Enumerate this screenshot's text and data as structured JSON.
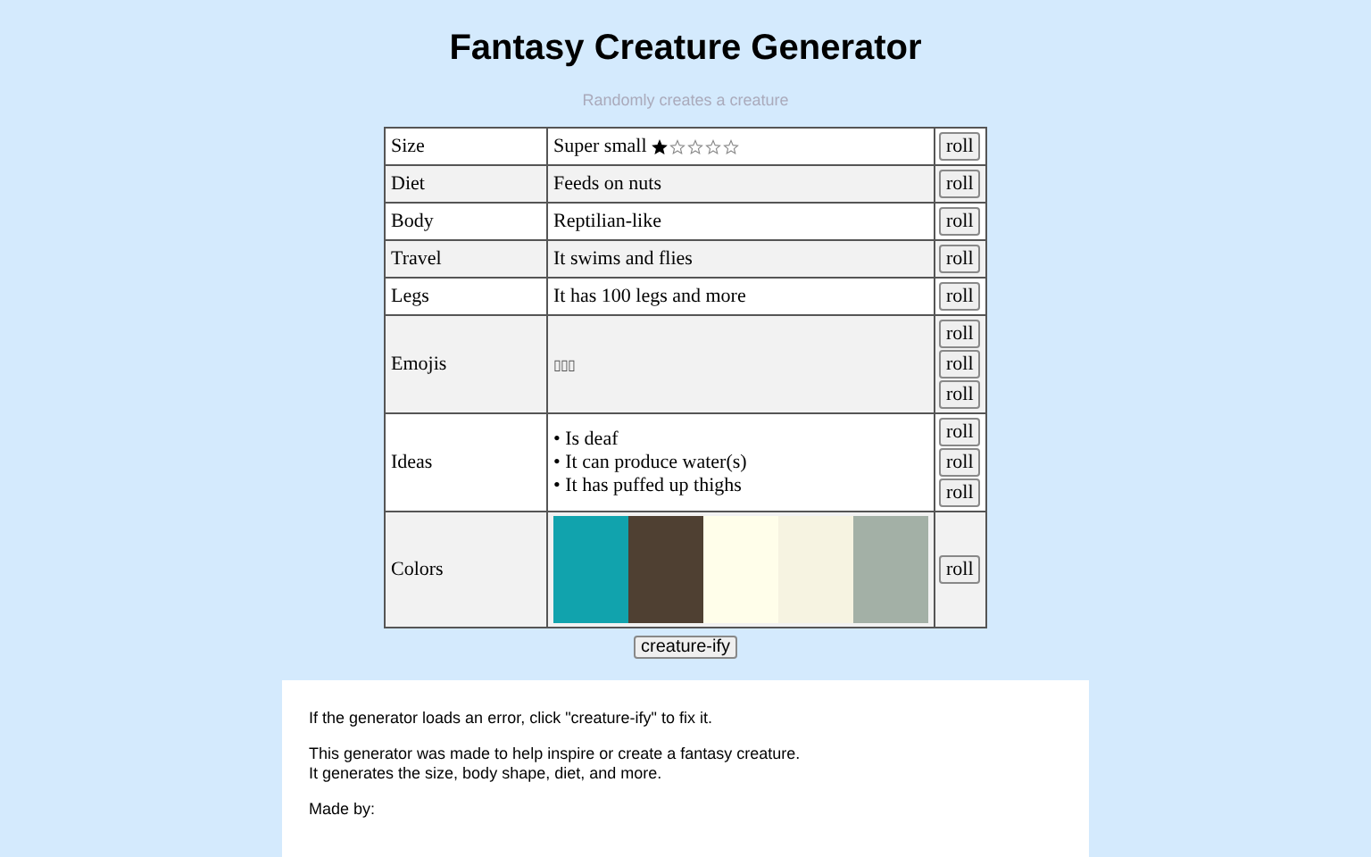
{
  "title": "Fantasy Creature Generator",
  "subtitle": "Randomly creates a creature",
  "rows": [
    {
      "kind": "stars",
      "label": "Size",
      "value": "Super small",
      "stars": 1,
      "buttons": [
        "roll"
      ]
    },
    {
      "kind": "text",
      "label": "Diet",
      "value": "Feeds on nuts",
      "buttons": [
        "roll"
      ]
    },
    {
      "kind": "text",
      "label": "Body",
      "value": "Reptilian-like",
      "buttons": [
        "roll"
      ]
    },
    {
      "kind": "text",
      "label": "Travel",
      "value": "It swims and flies",
      "buttons": [
        "roll"
      ]
    },
    {
      "kind": "text",
      "label": "Legs",
      "value": "It has 100 legs and more",
      "buttons": [
        "roll"
      ]
    },
    {
      "kind": "emoji",
      "label": "Emojis",
      "value": "▯▯▯",
      "buttons": [
        "roll",
        "roll",
        "roll"
      ]
    },
    {
      "kind": "list",
      "label": "Ideas",
      "items": [
        "• Is deaf",
        "• It can produce water(s)",
        "• It has puffed up thighs"
      ],
      "buttons": [
        "roll",
        "roll",
        "roll"
      ]
    },
    {
      "kind": "swatches",
      "label": "Colors",
      "swatches": [
        {
          "color": "#11a3ad"
        },
        {
          "color": "#4f4032"
        },
        {
          "color": "#fffeea"
        },
        {
          "color": "#f6f3e1"
        },
        {
          "color": "#a3b0a6"
        }
      ],
      "buttons": [
        "roll"
      ]
    }
  ],
  "main_button": "creature-ify",
  "info": [
    "If the generator loads an error, click \"creature-ify\" to fix it.",
    "This generator was made to help inspire or create a fantasy creature.\nIt generates the size, body shape, diet, and more.",
    "Made by:"
  ]
}
